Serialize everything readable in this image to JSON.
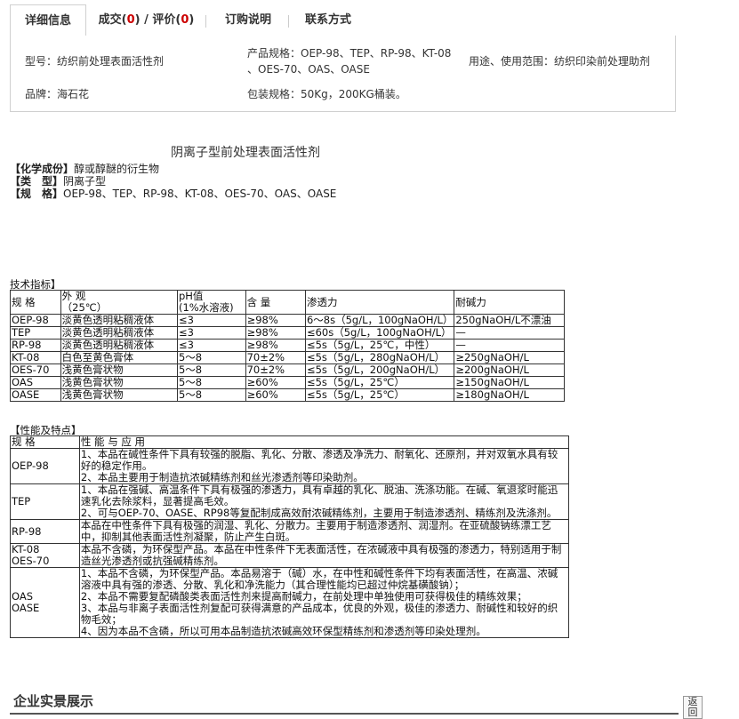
{
  "tabs": [
    {
      "label": "详细信息"
    },
    {
      "prefix": "成交(",
      "count": "0",
      "mid": ") / 评价(",
      "count2": "0",
      "suffix": ")"
    },
    {
      "label": "订购说明"
    },
    {
      "label": "联系方式"
    }
  ],
  "attrs": {
    "model": "型号：纺织前处理表面活性剂",
    "brand": "品牌：海石花",
    "spec_line1": "产品规格：OEP-98、TEP、RP-98、KT-08",
    "spec_line2": "、OES-70、OAS、OASE",
    "packing": "包装规格：50Kg，200KG桶装。",
    "usage": "用途、使用范围：纺织印染前处理助剂"
  },
  "doc": {
    "title": "阴离子型前处理表面活性剂",
    "composition_label": "【化学成份】",
    "composition": "醇或醇醚的衍生物",
    "type_label": "【类　型】",
    "type": "阴离子型",
    "spec_label": "【规　格】",
    "spec": "OEP-98、TEP、RP-98、KT-08、OES-70、OAS、OASE"
  },
  "tech": {
    "label": "技术指标】",
    "headers": {
      "spec": "规 格",
      "appearance1": "外 观",
      "appearance2": "（25℃）",
      "ph1": "pH值",
      "ph2": "(1%水溶液)",
      "content": "含 量",
      "penetration": "渗透力",
      "alkali": "耐碱力"
    },
    "rows": [
      {
        "spec": "OEP-98",
        "appearance": "淡黄色透明粘稠液体",
        "ph": "≤3",
        "content": "≥98%",
        "penetration": "6～8s（5g/L，100gNaOH/L）",
        "alkali": "250gNaOH/L不漂油"
      },
      {
        "spec": "TEP",
        "appearance": "淡黄色透明粘稠液体",
        "ph": "≤3",
        "content": "≥98%",
        "penetration": "≤60s（5g/L，100gNaOH/L）",
        "alkali": "—"
      },
      {
        "spec": "RP-98",
        "appearance": "淡黄色透明粘稠液体",
        "ph": "≤3",
        "content": "≥98%",
        "penetration": "≤5s（5g/L，25℃，中性）",
        "alkali": "—"
      },
      {
        "spec": "KT-08",
        "appearance": "白色至黄色膏体",
        "ph": "5～8",
        "content": "70±2%",
        "penetration": "≤5s（5g/L，280gNaOH/L）",
        "alkali": "≥250gNaOH/L"
      },
      {
        "spec": "OES-70",
        "appearance": "浅黄色膏状物",
        "ph": "5～8",
        "content": "70±2%",
        "penetration": "≤5s（5g/L，200gNaOH/L）",
        "alkali": "≥200gNaOH/L"
      },
      {
        "spec": "OAS",
        "appearance": "浅黄色膏状物",
        "ph": "5～8",
        "content": "≥60%",
        "penetration": "≤5s（5g/L，25℃）",
        "alkali": "≥150gNaOH/L"
      },
      {
        "spec": "OASE",
        "appearance": "浅黄色膏状物",
        "ph": "5～8",
        "content": "≥60%",
        "penetration": "≤5s（5g/L，25℃）",
        "alkali": "≥180gNaOH/L"
      }
    ]
  },
  "features": {
    "label": "【性能及特点】",
    "headers": {
      "spec": "规 格",
      "desc": "性 能 与 应 用"
    },
    "rows": [
      {
        "spec": "OEP-98",
        "desc": [
          "1、本品在碱性条件下具有较强的脱脂、乳化、分散、渗透及净洗力、耐氧化、还原剂，并对双氧水具有较好的稳定作用。",
          "2、本品主要用于制造抗浓碱精练剂和丝光渗透剂等印染助剂。"
        ]
      },
      {
        "spec": "TEP",
        "desc": [
          "1、本品在强碱、高温条件下具有极强的渗透力，具有卓越的乳化、脱油、洗涤功能。在碱、氧退浆时能迅速乳化去除浆料，显著提高毛效。",
          "2、可与OEP-70、OASE、RP98等复配制成高效耐浓碱精练剂，主要用于制造渗透剂、精练剂及洗涤剂。"
        ]
      },
      {
        "spec": "RP-98",
        "desc": [
          "本品在中性条件下具有极强的润湿、乳化、分散力。主要用于制造渗透剂、润湿剂。在亚硫酸钠练漂工艺中，抑制其他表面活性剂凝聚，防止产生白斑。"
        ]
      },
      {
        "spec": "KT-08",
        "spec2": "OES-70",
        "desc": [
          "本品不含磷，为环保型产品。本品在中性条件下无表面活性，在浓碱液中具有极强的渗透力，特别适用于制造丝光渗透剂或抗强碱精练剂。"
        ]
      },
      {
        "spec": "OAS",
        "spec2": "OASE",
        "desc": [
          "1、本品不含磷，为环保型产品。本品易溶于（碱）水，在中性和碱性条件下均有表面活性，在高温、浓碱溶液中具有强的渗透、分散、乳化和净洗能力（其合理性能均已超过仲烷基磺酸钠）；",
          "2、本品不需要复配磷酸类表面活性剂来提高耐碱力，在前处理中单独使用可获得极佳的精练效果；",
          "3、本品与非离子表面活性剂复配可获得满意的产品成本，优良的外观，极佳的渗透力、耐碱性和较好的织物毛效；",
          "4、因为本品不含磷，所以可用本品制造抗浓碱高效环保型精练剂和渗透剂等印染处理剂。"
        ]
      }
    ]
  },
  "showcase": {
    "title": "企业实景展示"
  },
  "back_button": {
    "label": "返回"
  }
}
